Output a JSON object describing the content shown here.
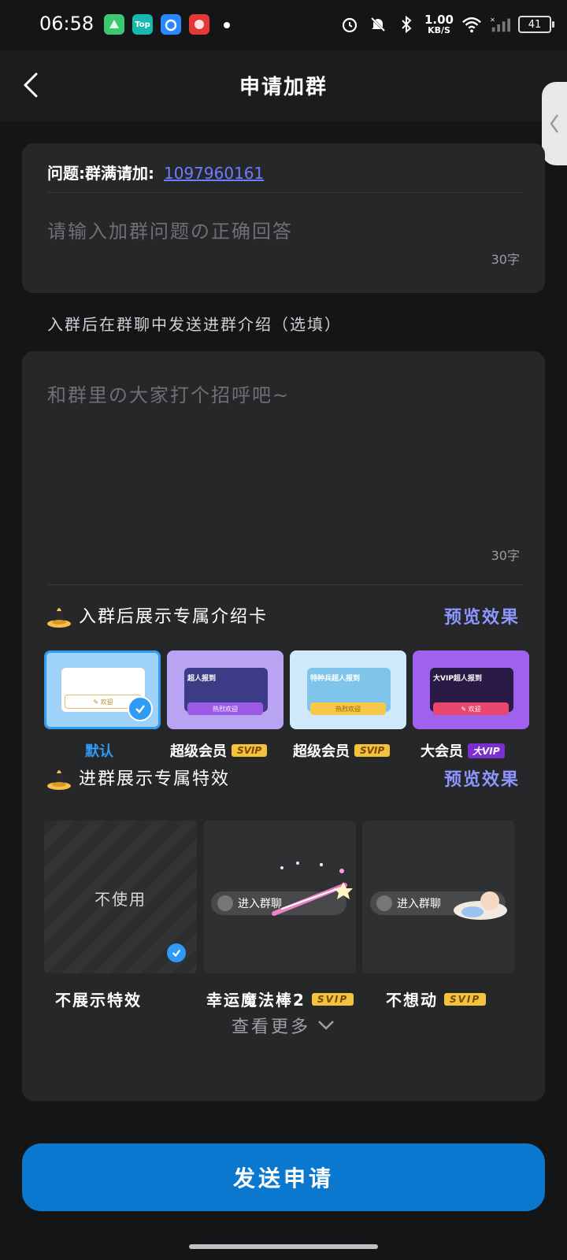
{
  "status_bar": {
    "time": "06:58",
    "net_speed_value": "1.00",
    "net_speed_unit": "KB/S",
    "battery": "41",
    "icons": [
      "app-icon-green",
      "app-icon-top",
      "app-icon-blue",
      "app-icon-red",
      "alarm-icon",
      "mute-icon",
      "bluetooth-icon",
      "wifi-icon",
      "signal-icon",
      "battery-icon"
    ],
    "app_top_label": "Top"
  },
  "header": {
    "title": "申请加群",
    "back_icon": "chevron-left-icon"
  },
  "question_card": {
    "question_label": "问题:群满请加:",
    "question_value": "1097960161",
    "answer_placeholder": "请输入加群问题の正确回答",
    "answer_counter": "30字"
  },
  "intro": {
    "label": "入群后在群聊中发送进群介绍（选填）",
    "placeholder": "和群里の大家打个招呼吧~",
    "counter": "30字"
  },
  "intro_cards": {
    "title": "入群后展示专属介绍卡",
    "preview_link": "预览效果",
    "items": [
      {
        "label": "默认",
        "badge": "",
        "selected": true,
        "mini_title": "",
        "mini_button": "✎ 欢迎"
      },
      {
        "label": "超级会员",
        "badge": "SVIP",
        "selected": false,
        "mini_title": "超人报到",
        "mini_button": "热烈欢迎"
      },
      {
        "label": "超级会员",
        "badge": "SVIP",
        "selected": false,
        "mini_title": "特种兵超人报到",
        "mini_button": "热烈欢迎"
      },
      {
        "label": "大会员",
        "badge": "大VIP",
        "selected": false,
        "mini_title": "大VIP超人报到",
        "mini_button": "✎ 欢迎"
      }
    ]
  },
  "effects": {
    "title": "进群展示专属特效",
    "preview_link": "预览效果",
    "items": [
      {
        "label": "不展示特效",
        "badge": "",
        "center_text": "不使用",
        "pill_text": "",
        "selected": true
      },
      {
        "label": "幸运魔法棒2",
        "badge": "SVIP",
        "center_text": "",
        "pill_text": "进入群聊",
        "selected": false
      },
      {
        "label": "不想动",
        "badge": "SVIP",
        "center_text": "",
        "pill_text": "进入群聊",
        "selected": false
      }
    ]
  },
  "more": {
    "label": "查看更多",
    "icon": "chevron-down-icon"
  },
  "send_button": {
    "label": "发送申请"
  },
  "colors": {
    "background": "#141517",
    "card": "#262729",
    "accent_blue": "#0b78d0",
    "link_purple": "#8d96ff",
    "svip_gold": "#f4c23d"
  }
}
